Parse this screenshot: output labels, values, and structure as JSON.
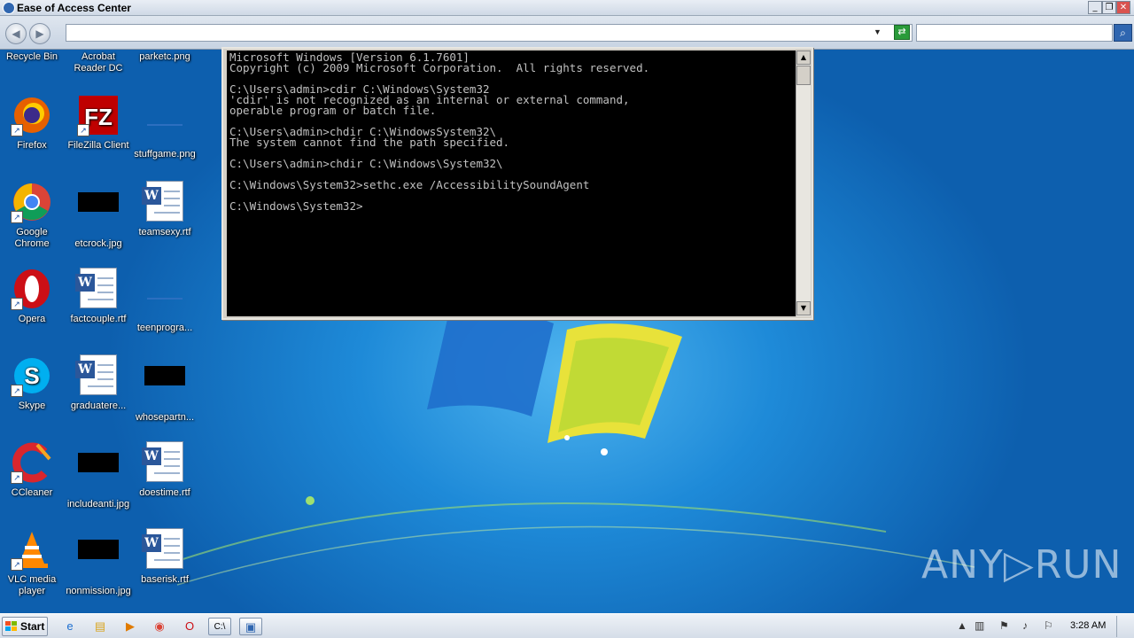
{
  "window": {
    "title": "Ease of Access Center",
    "controls": {
      "minimize": "_",
      "maximize": "❐",
      "close": "✕"
    }
  },
  "toolbar": {
    "address_value": "",
    "search_placeholder": ""
  },
  "desktop_icons": [
    {
      "label": "Recycle Bin",
      "icon": "recycle-bin-icon"
    },
    {
      "label": "Acrobat Reader DC",
      "icon": "acrobat-icon"
    },
    {
      "label": "parketc.png",
      "icon": "png-file-icon"
    },
    {
      "label": "Firefox",
      "icon": "firefox-icon"
    },
    {
      "label": "FileZilla Client",
      "icon": "filezilla-icon"
    },
    {
      "label": "stuffgame.png",
      "icon": "png-file-icon"
    },
    {
      "label": "Google Chrome",
      "icon": "chrome-icon"
    },
    {
      "label": "etcrock.jpg",
      "icon": "jpg-file-icon"
    },
    {
      "label": "teamsexy.rtf",
      "icon": "word-doc-icon"
    },
    {
      "label": "Opera",
      "icon": "opera-icon"
    },
    {
      "label": "factcouple.rtf",
      "icon": "word-doc-icon"
    },
    {
      "label": "teenprogra...",
      "icon": "png-file-icon"
    },
    {
      "label": "Skype",
      "icon": "skype-icon"
    },
    {
      "label": "graduatere...",
      "icon": "word-doc-icon"
    },
    {
      "label": "whosepartn...",
      "icon": "jpg-file-icon"
    },
    {
      "label": "CCleaner",
      "icon": "ccleaner-icon"
    },
    {
      "label": "includeanti.jpg",
      "icon": "jpg-file-icon"
    },
    {
      "label": "doestime.rtf",
      "icon": "word-doc-icon"
    },
    {
      "label": "VLC media player",
      "icon": "vlc-icon"
    },
    {
      "label": "nonmission.jpg",
      "icon": "jpg-file-icon"
    },
    {
      "label": "baserisk.rtf",
      "icon": "word-doc-icon"
    }
  ],
  "cmd": {
    "lines": [
      "Microsoft Windows [Version 6.1.7601]",
      "Copyright (c) 2009 Microsoft Corporation.  All rights reserved.",
      "",
      "C:\\Users\\admin>cdir C:\\Windows\\System32",
      "'cdir' is not recognized as an internal or external command,",
      "operable program or batch file.",
      "",
      "C:\\Users\\admin>chdir C:\\WindowsSystem32\\",
      "The system cannot find the path specified.",
      "",
      "C:\\Users\\admin>chdir C:\\Windows\\System32\\",
      "",
      "C:\\Windows\\System32>sethc.exe /AccessibilitySoundAgent",
      "",
      "C:\\Windows\\System32>"
    ]
  },
  "watermark": "ANY▷RUN",
  "taskbar": {
    "start_label": "Start",
    "pinned": [
      "ie-icon",
      "explorer-icon",
      "media-player-icon",
      "chrome-icon",
      "opera-icon",
      "cmd-icon",
      "ease-of-access-icon"
    ],
    "clock": "3:28 AM"
  }
}
